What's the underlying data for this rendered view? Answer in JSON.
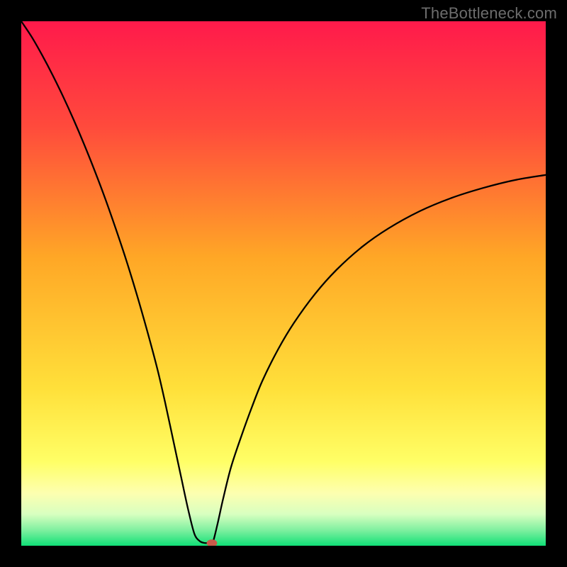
{
  "watermark": {
    "text": "TheBottleneck.com"
  },
  "chart_data": {
    "type": "line",
    "title": "",
    "xlabel": "",
    "ylabel": "",
    "xlim": [
      0,
      100
    ],
    "ylim": [
      0,
      100
    ],
    "grid": false,
    "legend": false,
    "background_gradient": {
      "stops": [
        {
          "offset": 0.0,
          "color": "#ff1a4b"
        },
        {
          "offset": 0.2,
          "color": "#ff4a3c"
        },
        {
          "offset": 0.45,
          "color": "#ffa726"
        },
        {
          "offset": 0.7,
          "color": "#ffe03a"
        },
        {
          "offset": 0.84,
          "color": "#ffff66"
        },
        {
          "offset": 0.9,
          "color": "#fdffb0"
        },
        {
          "offset": 0.94,
          "color": "#d8ffc0"
        },
        {
          "offset": 0.97,
          "color": "#80f0a0"
        },
        {
          "offset": 1.0,
          "color": "#11e077"
        }
      ]
    },
    "series": [
      {
        "name": "curve",
        "stroke": "#000000",
        "stroke_width": 2.3,
        "x": [
          0,
          2,
          4,
          6,
          8,
          10,
          12,
          14,
          16,
          18,
          20,
          22,
          24,
          26,
          27.5,
          29,
          30.5,
          31.8,
          33,
          34,
          34.8,
          35.5,
          36,
          36.35,
          36.7,
          37.5,
          38.5,
          40,
          42,
          44,
          46,
          49,
          52,
          56,
          60,
          65,
          70,
          76,
          82,
          88,
          94,
          100
        ],
        "y": [
          100,
          97,
          93.5,
          89.7,
          85.6,
          81.2,
          76.5,
          71.5,
          66.2,
          60.5,
          54.5,
          48.0,
          41.0,
          33.5,
          27,
          20,
          13,
          7,
          2.3,
          0.9,
          0.55,
          0.5,
          0.5,
          0.5,
          1.2,
          4.5,
          9,
          15,
          21,
          26.5,
          31.5,
          37.5,
          42.5,
          48,
          52.5,
          57,
          60.5,
          63.8,
          66.3,
          68.2,
          69.7,
          70.7
        ]
      }
    ],
    "marker": {
      "x": 36.35,
      "y": 0.5,
      "rx": 1.0,
      "ry": 0.7,
      "color": "#c85a4a"
    },
    "annotations": []
  }
}
